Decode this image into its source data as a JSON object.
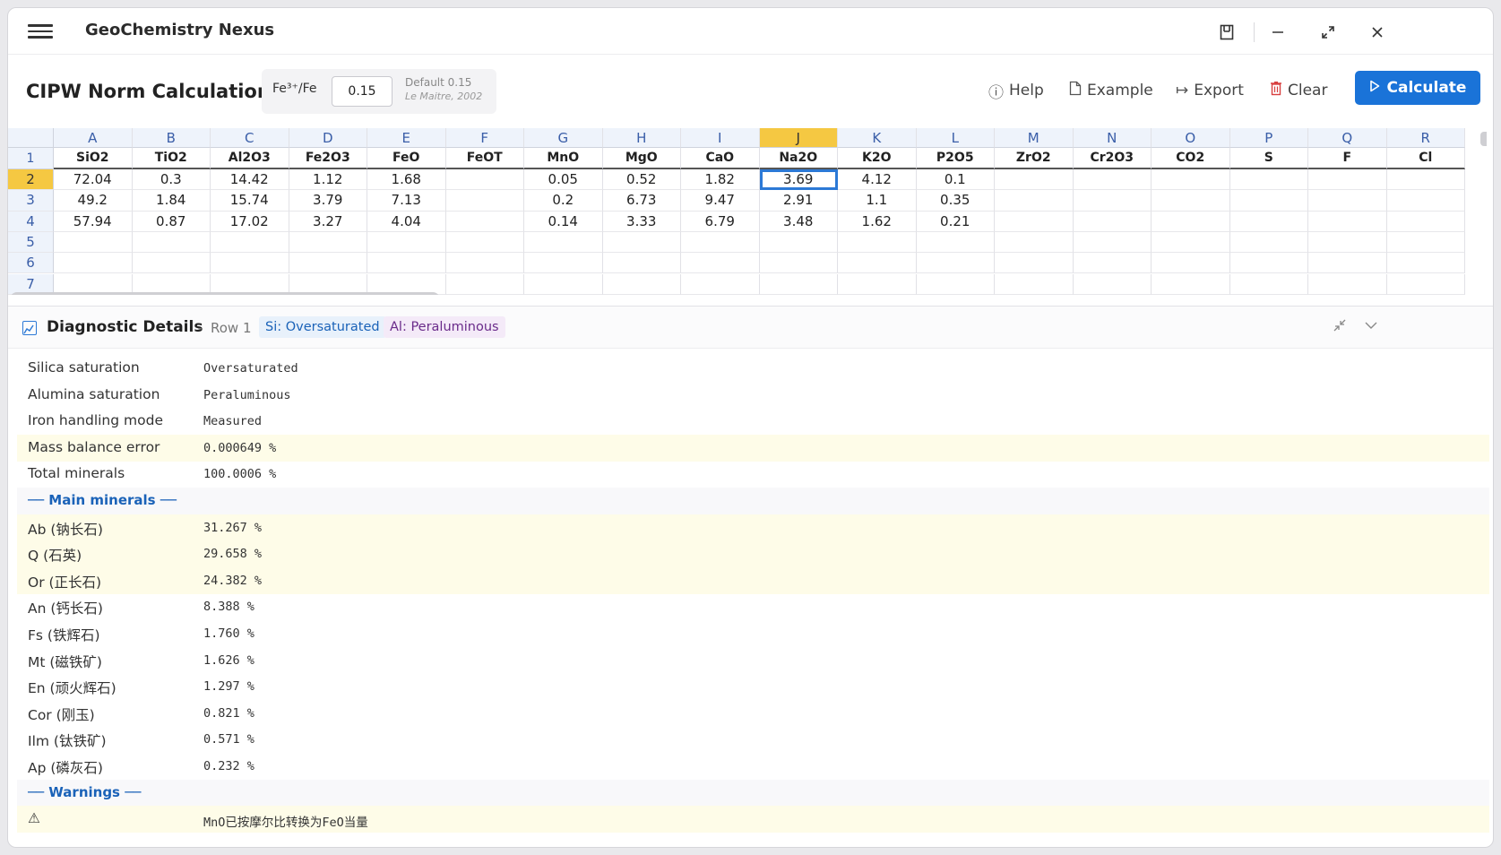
{
  "app": {
    "title": "GeoChemistry Nexus"
  },
  "toolbar": {
    "page_title": "CIPW Norm Calculation",
    "fe_label": "Fe³⁺/Fe",
    "fe_value": "0.15",
    "fe_default": "Default 0.15",
    "fe_source": "Le Maitre, 2002",
    "help": "Help",
    "example": "Example",
    "export": "Export",
    "clear": "Clear",
    "calculate": "Calculate"
  },
  "sheet": {
    "columns": [
      "A",
      "B",
      "C",
      "D",
      "E",
      "F",
      "G",
      "H",
      "I",
      "J",
      "K",
      "L",
      "M",
      "N",
      "O",
      "P",
      "Q",
      "R"
    ],
    "active_column": "J",
    "headers": [
      "SiO2",
      "TiO2",
      "Al2O3",
      "Fe2O3",
      "FeO",
      "FeOT",
      "MnO",
      "MgO",
      "CaO",
      "Na2O",
      "K2O",
      "P2O5",
      "ZrO2",
      "Cr2O3",
      "CO2",
      "S",
      "F",
      "Cl"
    ],
    "rows": [
      {
        "num": "2",
        "cells": [
          "72.04",
          "0.3",
          "14.42",
          "1.12",
          "1.68",
          "",
          "0.05",
          "0.52",
          "1.82",
          "3.69",
          "4.12",
          "0.1",
          "",
          "",
          "",
          "",
          "",
          ""
        ]
      },
      {
        "num": "3",
        "cells": [
          "49.2",
          "1.84",
          "15.74",
          "3.79",
          "7.13",
          "",
          "0.2",
          "6.73",
          "9.47",
          "2.91",
          "1.1",
          "0.35",
          "",
          "",
          "",
          "",
          "",
          ""
        ]
      },
      {
        "num": "4",
        "cells": [
          "57.94",
          "0.87",
          "17.02",
          "3.27",
          "4.04",
          "",
          "0.14",
          "3.33",
          "6.79",
          "3.48",
          "1.62",
          "0.21",
          "",
          "",
          "",
          "",
          "",
          ""
        ]
      },
      {
        "num": "5",
        "cells": [
          "",
          "",
          "",
          "",
          "",
          "",
          "",
          "",
          "",
          "",
          "",
          "",
          "",
          "",
          "",
          "",
          "",
          ""
        ]
      },
      {
        "num": "6",
        "cells": [
          "",
          "",
          "",
          "",
          "",
          "",
          "",
          "",
          "",
          "",
          "",
          "",
          "",
          "",
          "",
          "",
          "",
          ""
        ]
      },
      {
        "num": "7",
        "cells": [
          "",
          "",
          "",
          "",
          "",
          "",
          "",
          "",
          "",
          "",
          "",
          "",
          "",
          "",
          "",
          "",
          "",
          ""
        ]
      }
    ],
    "header_row_num": "1",
    "selected_row": "2",
    "selected_cell": "3.69"
  },
  "diagnostics": {
    "title": "Diagnostic Details",
    "sep": "-",
    "row": "Row 1",
    "badge_si": "Si: Oversaturated",
    "badge_al": "Al: Peraluminous",
    "items": [
      {
        "label": "Silica saturation",
        "value": "Oversaturated"
      },
      {
        "label": "Alumina saturation",
        "value": "Peraluminous"
      },
      {
        "label": "Iron handling mode",
        "value": "Measured"
      },
      {
        "label": "Mass balance error",
        "value": "0.000649 %"
      },
      {
        "label": "Total minerals",
        "value": "100.0006 %"
      }
    ],
    "main_minerals_title": "── Main minerals ──",
    "minerals": [
      {
        "label": "Ab (钠长石)",
        "value": "31.267 %"
      },
      {
        "label": "Q (石英)",
        "value": "29.658 %"
      },
      {
        "label": "Or (正长石)",
        "value": "24.382 %"
      },
      {
        "label": "An (钙长石)",
        "value": "8.388 %"
      },
      {
        "label": "Fs (铁辉石)",
        "value": "1.760 %"
      },
      {
        "label": "Mt (磁铁矿)",
        "value": "1.626 %"
      },
      {
        "label": "En (顽火辉石)",
        "value": "1.297 %"
      },
      {
        "label": "Cor (刚玉)",
        "value": "0.821 %"
      },
      {
        "label": "Ilm (钛铁矿)",
        "value": "0.571 %"
      },
      {
        "label": "Ap (磷灰石)",
        "value": "0.232 %"
      }
    ],
    "warnings_title": "── Warnings ──",
    "warning_icon": "⚠",
    "warning_text": "MnO已按摩尔比转换为FeO当量"
  }
}
